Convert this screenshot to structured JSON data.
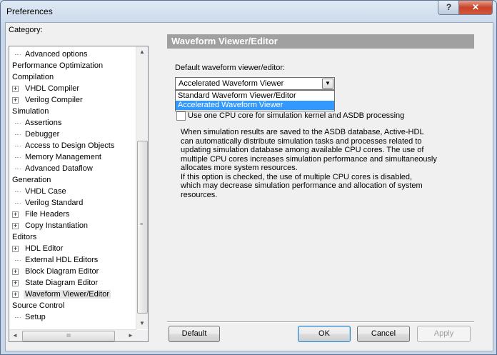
{
  "window": {
    "title": "Preferences",
    "help_label": "?",
    "close_label": "✕"
  },
  "category_label": "Category:",
  "tree": {
    "items": [
      {
        "label": "Advanced options",
        "level": 1,
        "expander": ""
      },
      {
        "label": "Performance Optimization",
        "level": 0,
        "expander": ""
      },
      {
        "label": "Compilation",
        "level": 0,
        "expander": ""
      },
      {
        "label": "VHDL Compiler",
        "level": 1,
        "expander": "+"
      },
      {
        "label": "Verilog Compiler",
        "level": 1,
        "expander": "+"
      },
      {
        "label": "Simulation",
        "level": 0,
        "expander": ""
      },
      {
        "label": "Assertions",
        "level": 1,
        "expander": ""
      },
      {
        "label": "Debugger",
        "level": 1,
        "expander": ""
      },
      {
        "label": "Access to Design Objects",
        "level": 1,
        "expander": ""
      },
      {
        "label": "Memory Management",
        "level": 1,
        "expander": ""
      },
      {
        "label": "Advanced Dataflow",
        "level": 1,
        "expander": ""
      },
      {
        "label": "Generation",
        "level": 0,
        "expander": ""
      },
      {
        "label": "VHDL Case",
        "level": 1,
        "expander": ""
      },
      {
        "label": "Verilog Standard",
        "level": 1,
        "expander": ""
      },
      {
        "label": "File Headers",
        "level": 1,
        "expander": "+"
      },
      {
        "label": "Copy Instantiation",
        "level": 1,
        "expander": "+"
      },
      {
        "label": "Editors",
        "level": 0,
        "expander": ""
      },
      {
        "label": "HDL Editor",
        "level": 1,
        "expander": "+"
      },
      {
        "label": "External HDL Editors",
        "level": 1,
        "expander": ""
      },
      {
        "label": "Block Diagram Editor",
        "level": 1,
        "expander": "+"
      },
      {
        "label": "State Diagram Editor",
        "level": 1,
        "expander": "+"
      },
      {
        "label": "Waveform Viewer/Editor",
        "level": 1,
        "expander": "+",
        "selected": true
      },
      {
        "label": "Source Control",
        "level": 0,
        "expander": ""
      },
      {
        "label": "Setup",
        "level": 1,
        "expander": ""
      }
    ],
    "scroll_up": "▲",
    "scroll_down": "▼",
    "scroll_left": "◄",
    "scroll_right": "►",
    "grip": "≡",
    "hgrip": "III"
  },
  "panel": {
    "header": "Waveform Viewer/Editor",
    "default_viewer_label": "Default waveform viewer/editor:",
    "selected_value": "Accelerated Waveform Viewer",
    "dropdown_arrow": "▼",
    "options": [
      "Standard Waveform Viewer/Editor",
      "Accelerated Waveform Viewer"
    ],
    "highlighted_option": "Accelerated Waveform Viewer",
    "cpu_checkbox_label": "Use one CPU core for simulation kernel and ASDB processing",
    "cpu_checked": false,
    "description": "When simulation results are saved to the ASDB database, Active-HDL\ncan automatically distribute simulation tasks and processes related to\nupdating simulation database among available CPU cores. The use of\nmultiple CPU cores increases simulation performance and simultaneously\nallocates more system resources.\nIf this option is checked, the use of multiple CPU cores is disabled,\nwhich may decrease simulation performance and allocation of system\nresources."
  },
  "buttons": {
    "default": "Default",
    "ok": "OK",
    "cancel": "Cancel",
    "apply": "Apply"
  }
}
